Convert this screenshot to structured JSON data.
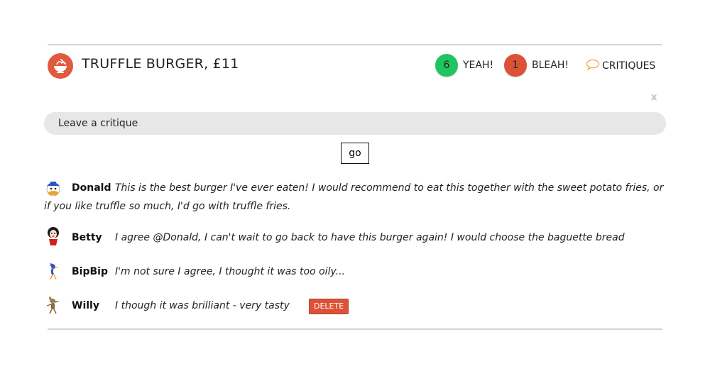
{
  "dish": {
    "title": "TRUFFLE BURGER, £11",
    "icon": "food-bowl-icon"
  },
  "votes": {
    "yeah": {
      "count": "6",
      "label": "YEAH!",
      "color": "#21c55d"
    },
    "bleah": {
      "count": "1",
      "label": "BLEAH!",
      "color": "#dd5236"
    }
  },
  "critiques_link": {
    "label": "CRITIQUES",
    "icon": "speech-bubble-icon",
    "icon_color": "#f0a030"
  },
  "close_label": "x",
  "critique_form": {
    "placeholder": "Leave a critique",
    "submit_label": "go"
  },
  "comments": [
    {
      "author": "Donald",
      "text": "This is the best burger I've ever eaten! I would recommend to eat this together with the sweet potato fries, or if you like truffle so much, I'd go with truffle fries.",
      "avatar": "donald-duck-avatar"
    },
    {
      "author": "Betty",
      "text": "I agree @Donald, I can't wait to go back to have this burger again! I would choose the baguette bread",
      "avatar": "betty-boop-avatar"
    },
    {
      "author": "BipBip",
      "text": "I'm not sure I agree, I thought it was too oily...",
      "avatar": "road-runner-avatar"
    },
    {
      "author": "Willy",
      "text": "I though it was brilliant - very tasty",
      "avatar": "wile-e-coyote-avatar",
      "delete_label": "DELETE"
    }
  ],
  "colors": {
    "accent": "#e05a3d",
    "input_bg": "#e7e7e7",
    "rule": "#d4d4d4"
  }
}
